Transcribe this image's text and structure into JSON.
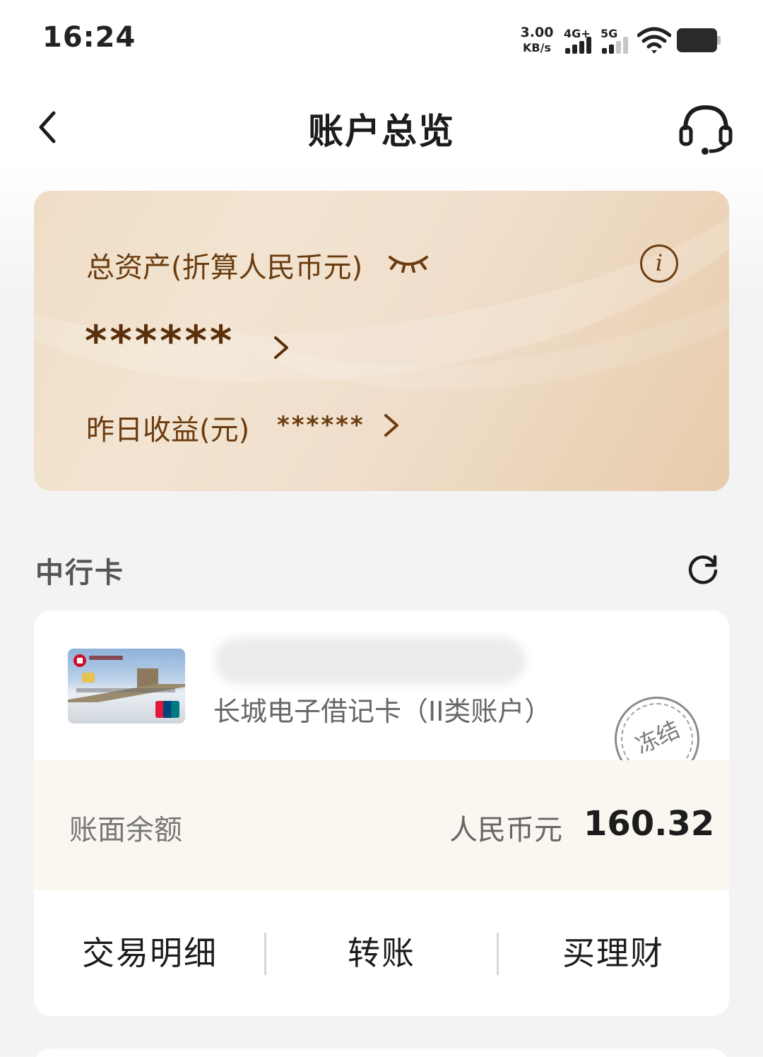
{
  "status_bar": {
    "time": "16:24",
    "net_speed_value": "3.00",
    "net_speed_unit": "KB/s",
    "sim1_label": "4G+",
    "sim2_label": "5G"
  },
  "header": {
    "title": "账户总览"
  },
  "assets": {
    "label": "总资产(折算人民币元)",
    "masked_value": "******",
    "yesterday_label": "昨日收益(元)",
    "yesterday_masked": "******",
    "info_glyph": "i"
  },
  "section": {
    "title": "中行卡"
  },
  "account": {
    "card_type": "长城电子借记卡（II类账户）",
    "status_stamp": "冻结",
    "balance_label": "账面余额",
    "currency": "人民币元",
    "balance": "160.32"
  },
  "actions": {
    "details": "交易明细",
    "transfer": "转账",
    "wealth": "买理财"
  },
  "icons": {
    "back": "chevron-left-icon",
    "customer_service": "headset-icon",
    "eye": "eye-closed-icon",
    "info": "info-icon",
    "refresh": "refresh-icon"
  },
  "colors": {
    "brown_text": "#6b3c10",
    "card_gradient_start": "#efddc6",
    "card_gradient_end": "#e7ccab"
  }
}
